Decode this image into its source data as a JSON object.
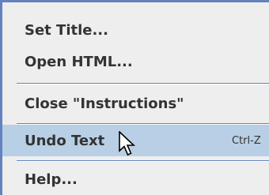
{
  "menu": {
    "items": [
      {
        "label": "Set Title...",
        "shortcut": ""
      },
      {
        "label": "Open HTML...",
        "shortcut": ""
      },
      {
        "label": "Close \"Instructions\"",
        "shortcut": ""
      },
      {
        "label": "Undo Text",
        "shortcut": "Ctrl-Z"
      },
      {
        "label": "Help...",
        "shortcut": ""
      }
    ],
    "highlighted_item": "Undo Text"
  },
  "colors": {
    "menu_background": "#eeeeee",
    "border": "#6382bf",
    "highlight": "#b8cfe5",
    "text": "#333333"
  },
  "icons": {
    "cursor": "mouse-pointer-icon"
  }
}
